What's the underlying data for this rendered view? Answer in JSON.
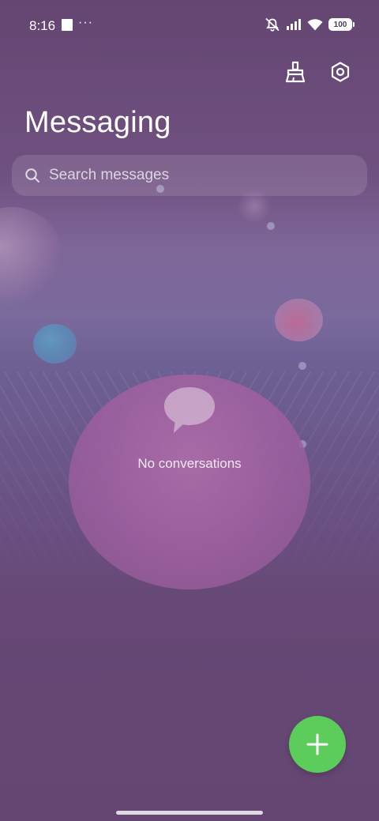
{
  "status_bar": {
    "time": "8:16",
    "more": "···",
    "battery_level": "100",
    "icons": [
      "screenshot-notification-icon",
      "mute-vibrate-icon",
      "cellular-signal-icon",
      "wifi-icon",
      "battery-icon"
    ]
  },
  "header": {
    "title": "Messaging",
    "actions": [
      "clean-icon",
      "settings-icon"
    ]
  },
  "search": {
    "placeholder": "Search messages",
    "icon": "search-icon"
  },
  "empty_state": {
    "text": "No conversations",
    "icon": "chat-bubble-icon"
  },
  "fab": {
    "icon": "plus-icon",
    "color": "#5ccc5b"
  },
  "colors": {
    "background": "#654672",
    "accent": "#5ccc5b"
  }
}
